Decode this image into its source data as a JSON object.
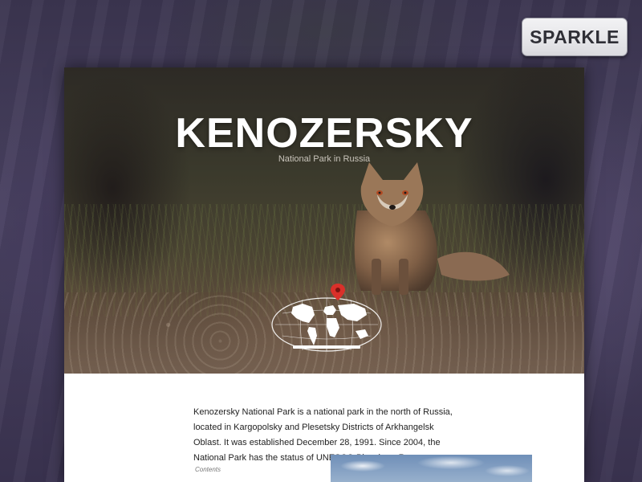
{
  "badge": {
    "label": "SPARKLE"
  },
  "hero": {
    "title": "KENOZERSKY",
    "subtitle": "National Park in Russia",
    "icons": {
      "location": "map-pin-icon",
      "map": "world-map-icon"
    }
  },
  "article": {
    "intro": "Kenozersky National Park is a national park in the north of Russia, located in Kargopolsky and Plesetsky Districts of Arkhangelsk Oblast. It was established December 28, 1991. Since 2004, the National Park has the status of UNESCO Biosphere Reserve.",
    "contents_label": "Contents"
  },
  "colors": {
    "pin": "#d9302a",
    "title": "#ffffff",
    "body_text": "#222222"
  }
}
